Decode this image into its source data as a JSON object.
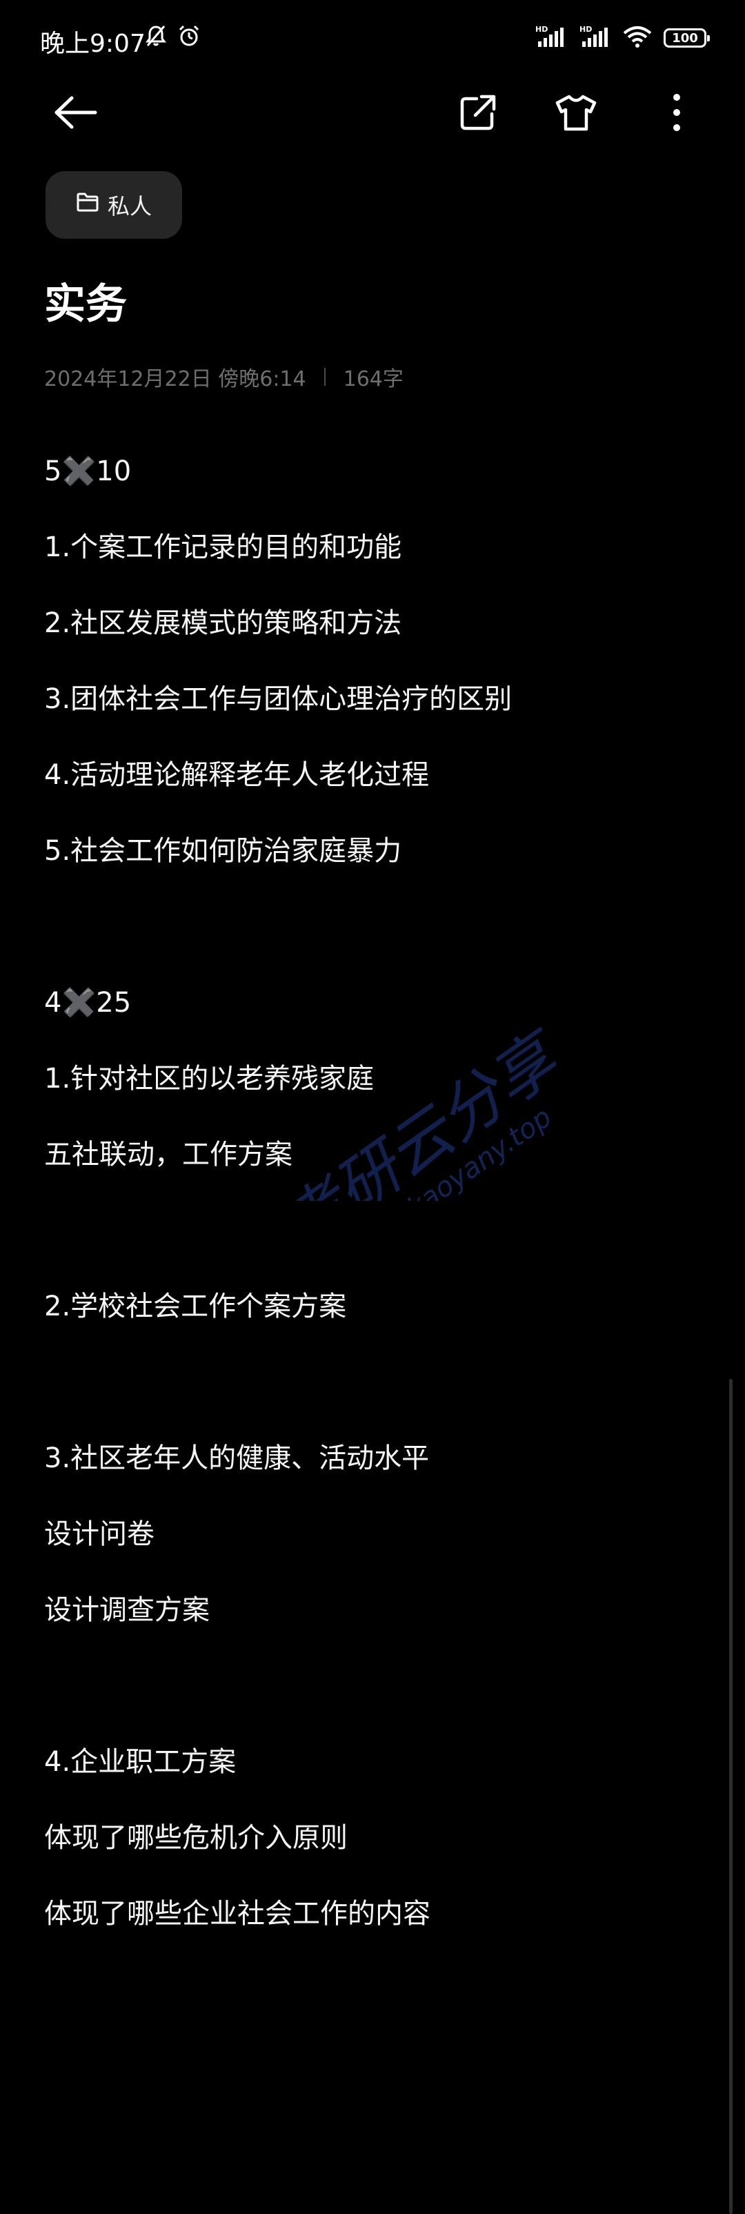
{
  "status_bar": {
    "time": "晚上9:07",
    "battery": "100",
    "left_icons": [
      "mute-bell-icon",
      "alarm-icon"
    ],
    "right_icons": [
      "signal-hd-icon",
      "signal-hd-icon",
      "wifi-icon",
      "battery-icon"
    ]
  },
  "toolbar": {
    "back_icon": "back-arrow-icon",
    "share_icon": "share-icon",
    "theme_icon": "shirt-icon",
    "more_icon": "more-vertical-icon"
  },
  "folder": {
    "label": "私人",
    "icon": "folder-icon"
  },
  "note": {
    "title": "实务",
    "date": "2024年12月22日 傍晚6:14",
    "word_count": "164字",
    "lines": [
      "5✖️10",
      "1.个案工作记录的目的和功能",
      "2.社区发展模式的策略和方法",
      "3.团体社会工作与团体心理治疗的区别",
      "4.活动理论解释老年人老化过程",
      "5.社会工作如何防治家庭暴力",
      "",
      "4✖️25",
      "1.针对社区的以老养残家庭",
      "五社联动，工作方案",
      "",
      "2.学校社会工作个案方案",
      "",
      "3.社区老年人的健康、活动水平",
      "设计问卷",
      "设计调查方案",
      "",
      "4.企业职工方案",
      "体现了哪些危机介入原则",
      "体现了哪些企业社会工作的内容"
    ]
  },
  "watermark": {
    "text_cn": "考研云分享",
    "text_url": "kaoyany.top",
    "color": "#1f3a8a"
  },
  "colors": {
    "background": "#000000",
    "text": "#f5f5f5",
    "meta": "#6e6e6e",
    "chip": "#262626"
  }
}
